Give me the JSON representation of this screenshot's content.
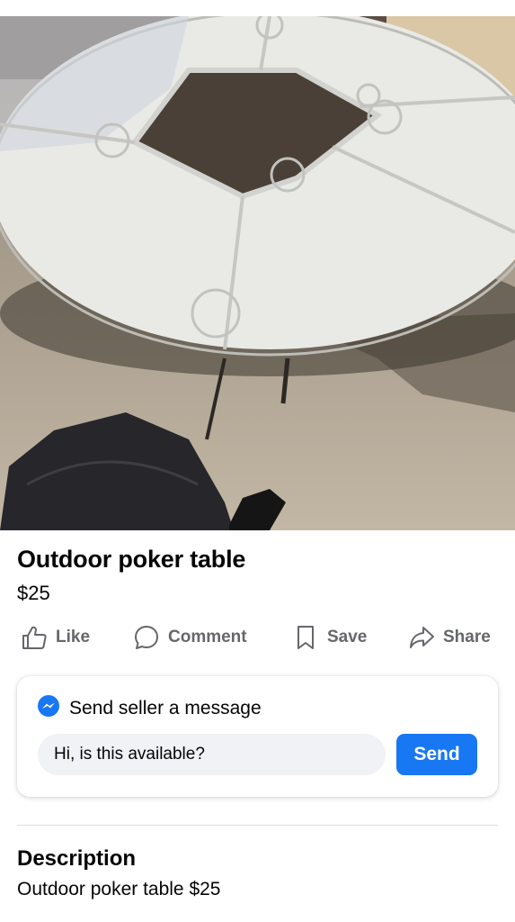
{
  "listing": {
    "title": "Outdoor poker table",
    "price": "$25",
    "photo_icon": "listing-photo"
  },
  "actions": [
    {
      "label": "Like",
      "icon": "thumbs-up-icon"
    },
    {
      "label": "Comment",
      "icon": "comment-bubble-icon"
    },
    {
      "label": "Save",
      "icon": "bookmark-icon"
    },
    {
      "label": "Share",
      "icon": "share-arrow-icon"
    }
  ],
  "message": {
    "heading": "Send seller a message",
    "icon": "messenger-icon",
    "input_value": "Hi, is this available?",
    "send_label": "Send",
    "accent": "#1877f2"
  },
  "description": {
    "heading": "Description",
    "text": "Outdoor poker table $25"
  },
  "colors": {
    "muted_text": "#65676b",
    "input_bg": "#f0f2f5"
  }
}
